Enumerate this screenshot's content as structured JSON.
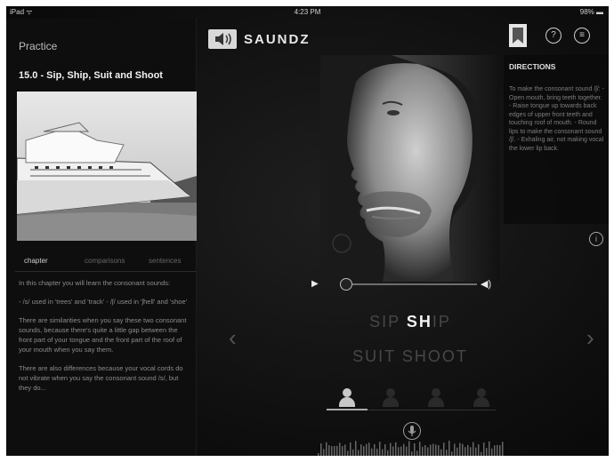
{
  "status_bar": {
    "carrier": "iPad ᯤ",
    "time": "4:23 PM",
    "battery": "98% ▬"
  },
  "header": {
    "section": "Practice",
    "logo_text": "SAUNDZ"
  },
  "lesson": {
    "title": "15.0 - Sip, Ship, Suit and Shoot",
    "tabs": [
      {
        "label": "chapter",
        "active": true
      },
      {
        "label": "comparisons",
        "active": false
      },
      {
        "label": "sentences",
        "active": false
      }
    ],
    "paragraphs": [
      "In this chapter you will learn the consonant sounds:",
      "- /s/ used in 'trees' and 'track' - /ʃ/ used in 'ʃhell' and 'shoe'",
      "There are similarities when you say these two consonant sounds, because there's quite a little gap between the front part of your tongue and the front part of the roof of your mouth when you say them.",
      "There are also differences because your vocal cords do not vibrate when you say the consonant sound /s/, but they do..."
    ]
  },
  "directions": {
    "title": "DIRECTIONS",
    "text": "To make the consonant sound /ʃ/: - Open mouth, bring teeth together. - Raise tongue up towards back edges of upper front teeth and touching roof of mouth. - Round lips to make the consonant sound /ʃ/. - Exhaling air, not making vocal the lower lip back."
  },
  "practice_words": {
    "row1": [
      {
        "text": "SIP",
        "highlight": false
      },
      {
        "text": "SH",
        "highlight": true
      },
      {
        "text": "IP",
        "highlight": false
      }
    ],
    "row2": [
      {
        "text": "SUIT",
        "highlight": false
      },
      {
        "text": "SHOOT",
        "highlight": false
      }
    ]
  },
  "icons": {
    "play": "play-icon",
    "volume": "volume-icon",
    "help": "?",
    "menu": "≡",
    "info": "i",
    "mic": "microphone-icon",
    "prev": "‹",
    "next": "›"
  },
  "colors": {
    "background": "#111111",
    "highlight": "#f2f2f2",
    "dim_word": "#474747"
  }
}
